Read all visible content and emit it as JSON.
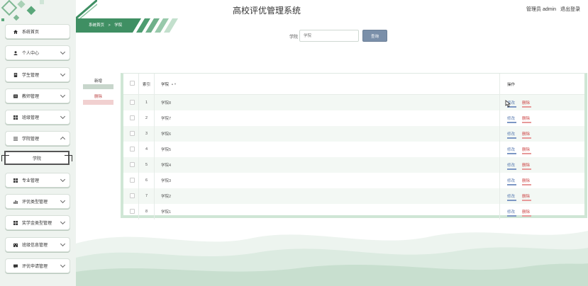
{
  "header": {
    "title": "高校评优管理系统",
    "user": "管理员 admin",
    "logout": "退出登录"
  },
  "breadcrumb": {
    "home": "系统首页",
    "sep": ">",
    "current": "学院"
  },
  "search": {
    "label": "学院",
    "placeholder": "学院",
    "button": "查询"
  },
  "actions": {
    "add": "新增",
    "delete": "删除"
  },
  "sidebar": {
    "items": [
      {
        "label": "系统首页",
        "icon": "home-icon",
        "has_chevron": false
      },
      {
        "label": "个人中心",
        "icon": "user-icon",
        "has_chevron": true
      },
      {
        "label": "学生管理",
        "icon": "doc-icon",
        "has_chevron": true
      },
      {
        "label": "教师管理",
        "icon": "card-icon",
        "has_chevron": true
      },
      {
        "label": "班级管理",
        "icon": "grid-icon",
        "has_chevron": true
      },
      {
        "label": "学院管理",
        "icon": "list-icon",
        "has_chevron": true,
        "expanded": true
      },
      {
        "label": "专业管理",
        "icon": "grid-icon",
        "has_chevron": true
      },
      {
        "label": "评优类型管理",
        "icon": "bar-chart-icon",
        "has_chevron": true
      },
      {
        "label": "奖学金类型管理",
        "icon": "grid-icon",
        "has_chevron": true
      },
      {
        "label": "班级信息管理",
        "icon": "building-icon",
        "has_chevron": true
      },
      {
        "label": "评优申请管理",
        "icon": "comment-icon",
        "has_chevron": true
      }
    ],
    "subitem": "学院"
  },
  "table": {
    "columns": {
      "index": "索引",
      "name": "学院",
      "op": "操作"
    },
    "rows": [
      {
        "index": "1",
        "name": "学院8"
      },
      {
        "index": "2",
        "name": "学院7"
      },
      {
        "index": "3",
        "name": "学院6"
      },
      {
        "index": "4",
        "name": "学院5"
      },
      {
        "index": "5",
        "name": "学院4"
      },
      {
        "index": "6",
        "name": "学院3"
      },
      {
        "index": "7",
        "name": "学院2"
      },
      {
        "index": "8",
        "name": "学院1"
      }
    ],
    "edit_label": "修改",
    "delete_label": "删除"
  },
  "colors": {
    "accent": "#3f8f63",
    "search_button": "#7a8fa9",
    "edit": "#5a7bb0",
    "delete": "#cc4444"
  }
}
